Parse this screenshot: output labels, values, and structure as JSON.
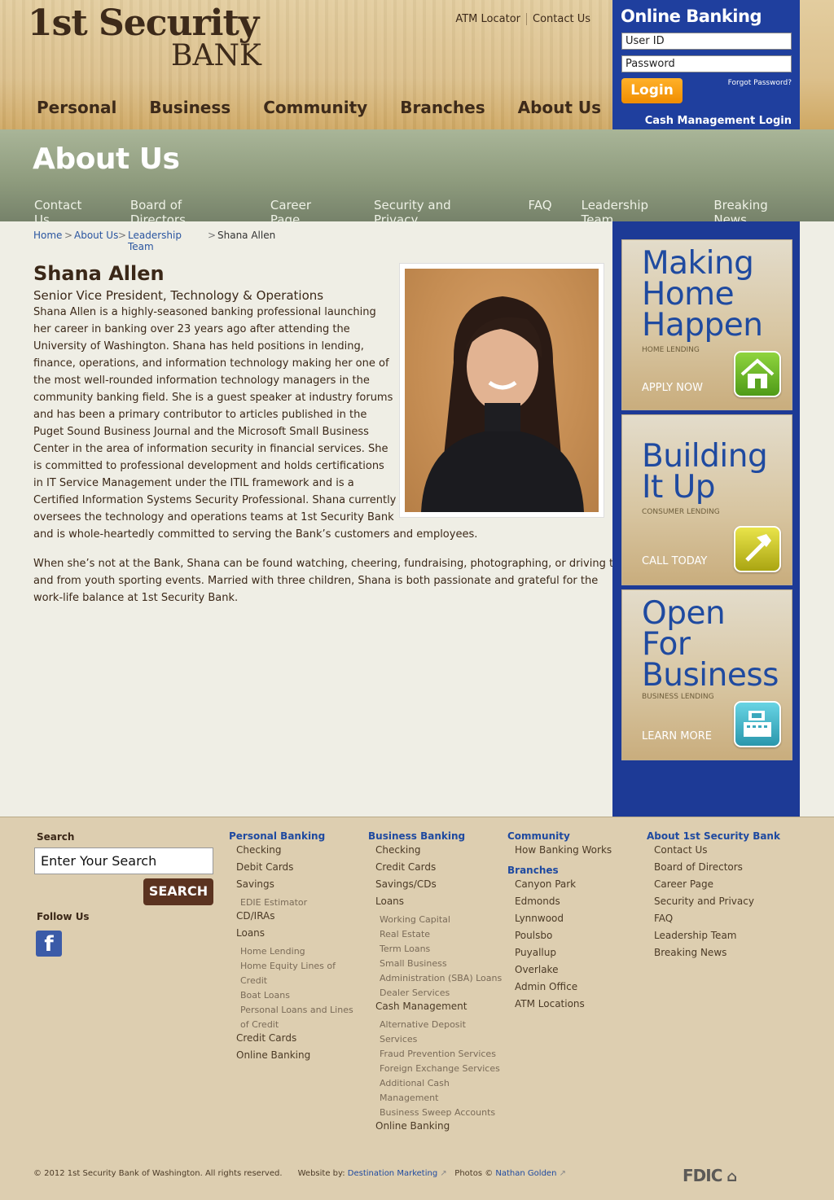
{
  "header": {
    "logo_line1": "1st Security",
    "logo_line2": "BANK",
    "utility_links": [
      "ATM Locator",
      "Contact Us"
    ],
    "main_nav": [
      "Personal",
      "Business",
      "Community",
      "Branches",
      "About Us"
    ]
  },
  "online_banking": {
    "title": "Online Banking",
    "user_id_placeholder": "User ID",
    "password_placeholder": "Password",
    "login_label": "Login",
    "forgot_password": "Forgot Password?",
    "cash_management_login": "Cash Management Login"
  },
  "subheader": {
    "title": "About Us",
    "subnav": [
      "Contact Us",
      "Board of Directors",
      "Career Page",
      "Security and Privacy",
      "FAQ",
      "Leadership Team",
      "Breaking News"
    ]
  },
  "breadcrumb": {
    "home": "Home",
    "about": "About Us",
    "leadership_line1": "Leadership",
    "leadership_line2": "Team",
    "current": "Shana Allen",
    "separator": ">"
  },
  "profile": {
    "name": "Shana Allen",
    "role": "Senior Vice President, Technology & Operations",
    "paragraph1_lines": [
      "Shana Allen is a highly-seasoned banking professional launching",
      "her career in banking over 23 years ago after attending the",
      "University of Washington. Shana has held positions in lending,",
      "finance, operations, and information technology making her one of",
      "the most well-rounded information technology managers in the",
      "community banking field. She is a guest speaker at industry forums",
      "and has been a primary contributor to articles published in the",
      "Puget Sound Business Journal and the Microsoft Small Business",
      "Center in the area of information security in financial services. She",
      "is committed to professional development and holds certifications",
      "in IT Service Management under the ITIL framework and is a",
      "Certified Information Systems Security Professional. Shana currently",
      "oversees the technology and operations teams at 1st Security Bank",
      "and is whole-heartedly committed to serving the Bank’s customers and employees."
    ],
    "paragraph2_lines": [
      "When she’s not at the Bank, Shana can be found watching, cheering, fundraising, photographing, or driving to",
      "and from youth sporting events. Married with three children, Shana is both passionate and grateful for the",
      "work-life balance at 1st Security Bank."
    ]
  },
  "promos": [
    {
      "headline": [
        "Making",
        "Home",
        "Happen"
      ],
      "category": "HOME LENDING",
      "cta": "APPLY NOW",
      "icon": "house-icon",
      "color": "#6fb52c"
    },
    {
      "headline": [
        "Building",
        "It Up"
      ],
      "category": "CONSUMER LENDING",
      "cta": "CALL TODAY",
      "icon": "hammer-icon",
      "color": "#c8c51e"
    },
    {
      "headline": [
        "Open",
        "For",
        "Business"
      ],
      "category": "BUSINESS LENDING",
      "cta": "LEARN MORE",
      "icon": "cash-register-icon",
      "color": "#3fb6c9"
    }
  ],
  "footer": {
    "search_label": "Search",
    "search_placeholder": "Enter Your Search",
    "search_button": "SEARCH",
    "follow_label": "Follow Us",
    "facebook_glyph": "f",
    "columns": [
      {
        "items": [
          {
            "t": "Personal Banking",
            "k": "h"
          },
          {
            "t": "Checking",
            "k": "1"
          },
          {
            "t": "Debit Cards",
            "k": "1"
          },
          {
            "t": "Savings",
            "k": "1"
          },
          {
            "t": "EDIE Estimator",
            "k": "2"
          },
          {
            "t": "CD/IRAs",
            "k": "1"
          },
          {
            "t": "Loans",
            "k": "1"
          },
          {
            "t": "Home Lending",
            "k": "2"
          },
          {
            "t": "Home Equity Lines of",
            "k": "2"
          },
          {
            "t": "Credit",
            "k": "2"
          },
          {
            "t": "Boat Loans",
            "k": "2"
          },
          {
            "t": "Personal Loans and Lines",
            "k": "2"
          },
          {
            "t": "of Credit",
            "k": "2"
          },
          {
            "t": "Credit Cards",
            "k": "1"
          },
          {
            "t": "Online Banking",
            "k": "1"
          }
        ]
      },
      {
        "items": [
          {
            "t": "Business Banking",
            "k": "h"
          },
          {
            "t": "Checking",
            "k": "1"
          },
          {
            "t": "Credit Cards",
            "k": "1"
          },
          {
            "t": "Savings/CDs",
            "k": "1"
          },
          {
            "t": "Loans",
            "k": "1"
          },
          {
            "t": "Working Capital",
            "k": "2"
          },
          {
            "t": "Real Estate",
            "k": "2"
          },
          {
            "t": "Term Loans",
            "k": "2"
          },
          {
            "t": "Small Business",
            "k": "2"
          },
          {
            "t": "Administration (SBA) Loans",
            "k": "2"
          },
          {
            "t": "Dealer Services",
            "k": "2"
          },
          {
            "t": "Cash Management",
            "k": "1"
          },
          {
            "t": "Alternative Deposit",
            "k": "2"
          },
          {
            "t": "Services",
            "k": "2"
          },
          {
            "t": "Fraud Prevention Services",
            "k": "2"
          },
          {
            "t": "Foreign Exchange Services",
            "k": "2"
          },
          {
            "t": "Additional Cash",
            "k": "2"
          },
          {
            "t": "Management",
            "k": "2"
          },
          {
            "t": "Business Sweep Accounts",
            "k": "2"
          },
          {
            "t": "Online Banking",
            "k": "1"
          }
        ]
      },
      {
        "items": [
          {
            "t": "Community",
            "k": "h"
          },
          {
            "t": "How Banking Works",
            "k": "1"
          },
          {
            "t": "Branches",
            "k": "h"
          },
          {
            "t": "Canyon Park",
            "k": "1"
          },
          {
            "t": "Edmonds",
            "k": "1"
          },
          {
            "t": "Lynnwood",
            "k": "1"
          },
          {
            "t": "Poulsbo",
            "k": "1"
          },
          {
            "t": "Puyallup",
            "k": "1"
          },
          {
            "t": "Overlake",
            "k": "1"
          },
          {
            "t": "Admin Office",
            "k": "1"
          },
          {
            "t": "ATM Locations",
            "k": "1"
          }
        ]
      },
      {
        "items": [
          {
            "t": "About 1st Security Bank",
            "k": "h"
          },
          {
            "t": "Contact Us",
            "k": "1"
          },
          {
            "t": "Board of Directors",
            "k": "1"
          },
          {
            "t": "Career Page",
            "k": "1"
          },
          {
            "t": "Security and Privacy",
            "k": "1"
          },
          {
            "t": "FAQ",
            "k": "1"
          },
          {
            "t": "Leadership Team",
            "k": "1"
          },
          {
            "t": "Breaking News",
            "k": "1"
          }
        ]
      }
    ],
    "copyright": "© 2012 1st Security Bank of Washington. All rights reserved.",
    "website_by_label": "Website by:",
    "website_by_link": "Destination Marketing",
    "photos_label": "Photos ©",
    "photos_link": "Nathan Golden",
    "fdic": "FDIC"
  }
}
